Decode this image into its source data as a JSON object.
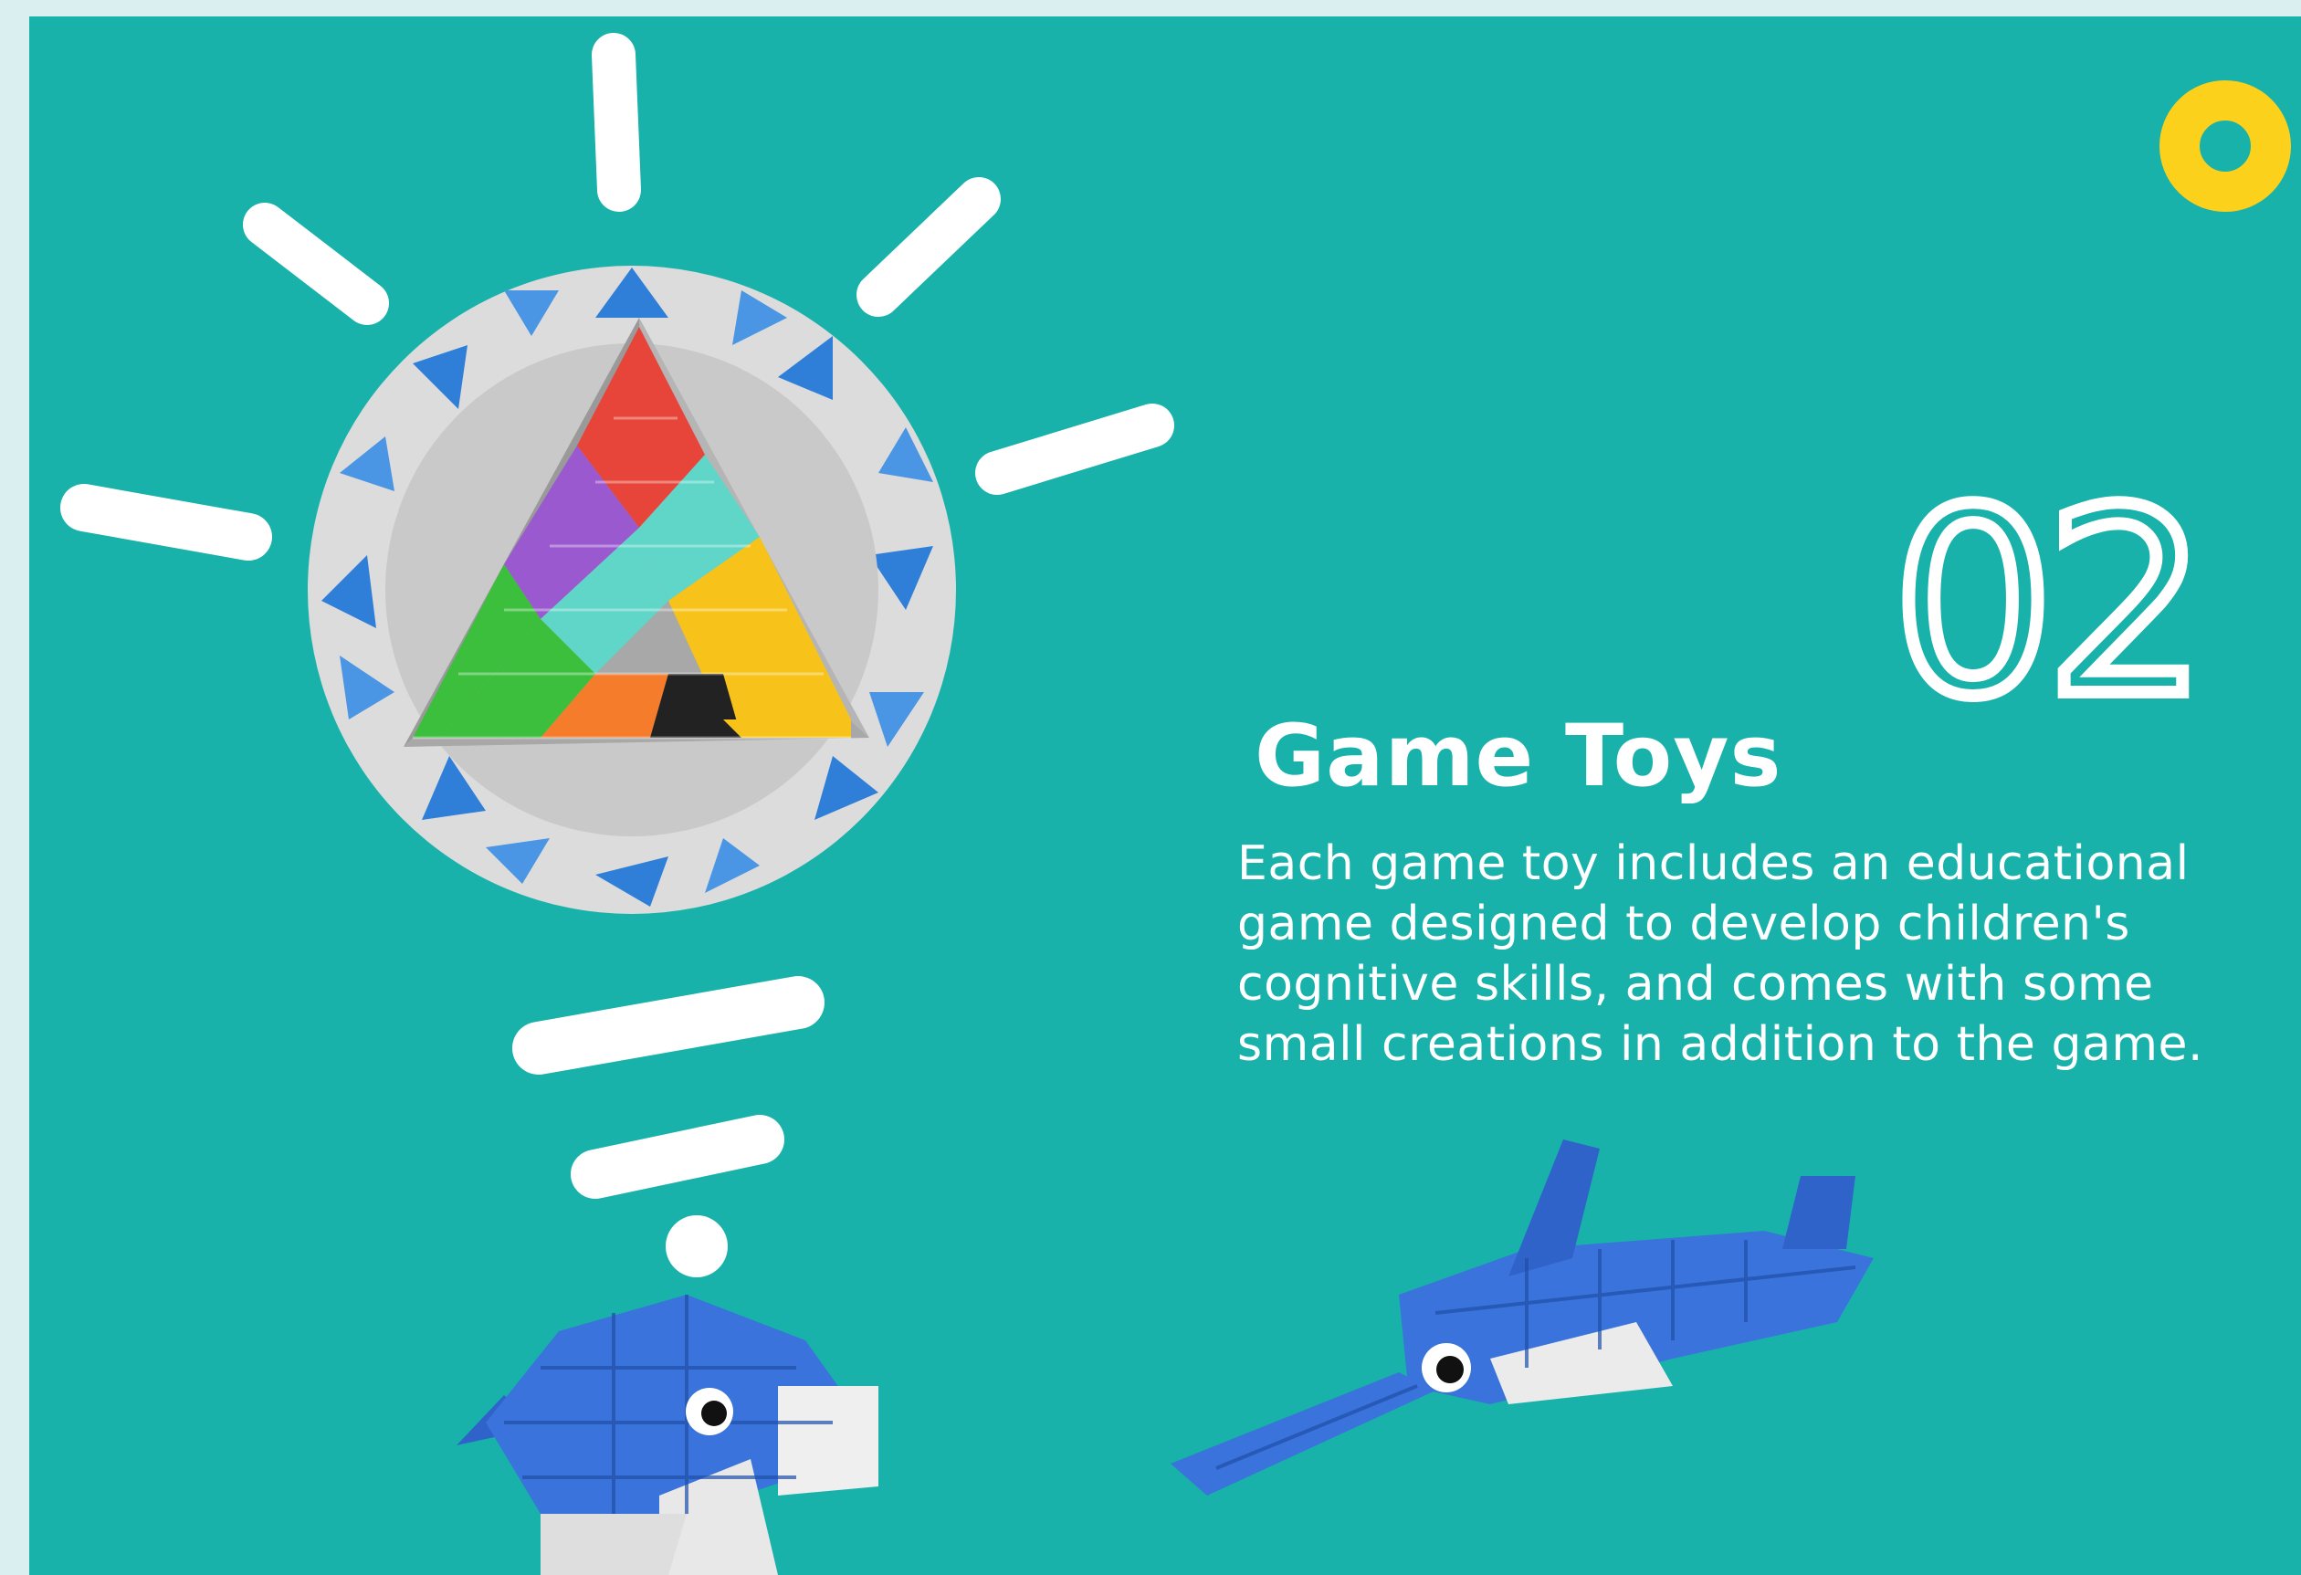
{
  "section": {
    "number": "02",
    "title": "Game Toys",
    "description": "Each game toy includes an educational game designed to develop children's cognitive skills, and comes with some small creations in addition to the game."
  },
  "colors": {
    "background": "#18b2ab",
    "frame": "#d9eff0",
    "accent_ring": "#fcd11c",
    "text": "#ffffff"
  },
  "images": {
    "bulb": "lightbulb-block-toy",
    "dolphin": "dolphin-block-toy",
    "shark": "shark-block-toy"
  }
}
